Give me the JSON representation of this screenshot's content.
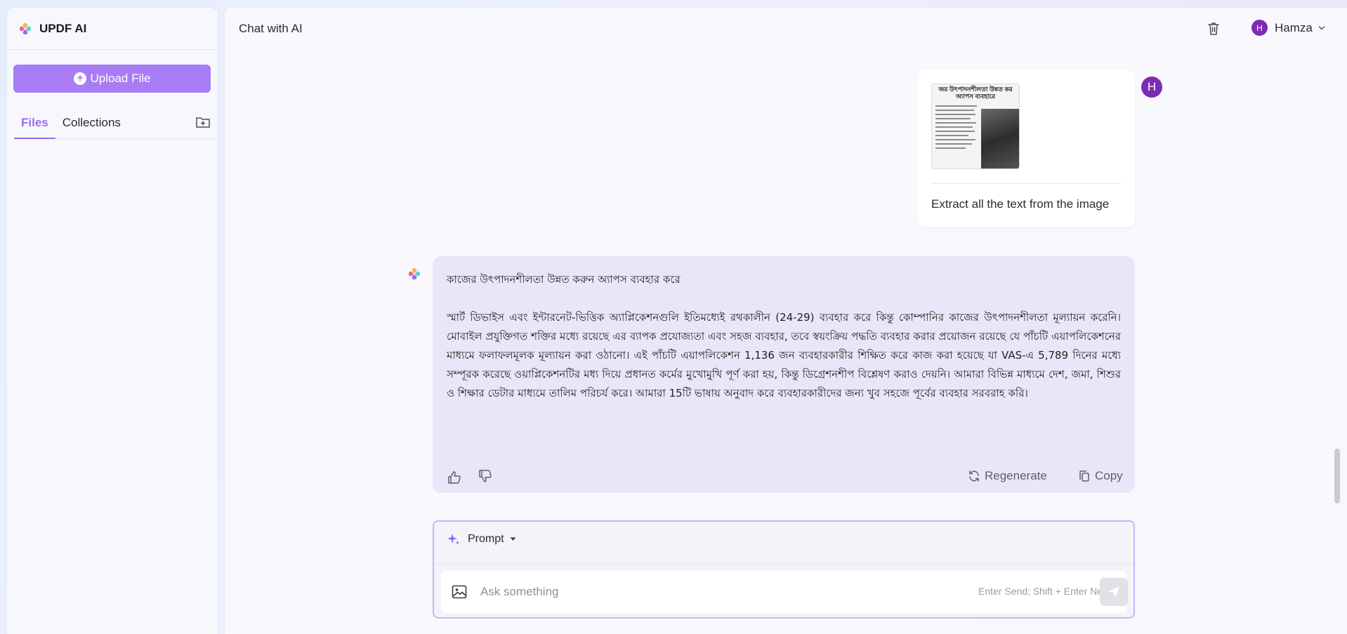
{
  "sidebar": {
    "brand": "UPDF AI",
    "upload_label": "Upload File",
    "tabs": [
      {
        "label": "Files"
      },
      {
        "label": "Collections"
      }
    ]
  },
  "header": {
    "title": "Chat with AI",
    "user_name": "Hamza",
    "user_initial": "H"
  },
  "user_message": {
    "thumb_title": "জর উৎপাদনশীলতা উন্নত কর অ্যাপস ব্যবহারে",
    "text": "Extract all the text from the image",
    "avatar_initial": "H"
  },
  "ai_message": {
    "title": "কাজের উৎপাদনশীলতা উন্নত করুন অ্যাপস ব্যবহার করে",
    "paragraph": "স্মার্ট ডিভাইস এবং ইন্টারনেট-ভিত্তিক অ্যাপ্লিকেশনগুলি ইতিমধ্যেই রথকালীন (24-29) ব্যবহার করে কিন্তু কোম্পানির কাজের উৎপাদনশীলতা মূল্যায়ন করেনি। মোবাইল প্রযুক্তিগত শক্তির মধ্যে রয়েছে এর ব্যাপক প্রযোজ্যতা এবং সহজ ব্যবহার, তবে স্বয়ংক্রিয় পদ্ধতি ব্যবহার করার প্রয়োজন রয়েছে যে পাঁচটি এয়াপলিকেশনের মাধ্যমে ফলাফলমূলক মূল্যায়ন করা ওঠানো। এই পাঁচটি এয়াপলিকেশন 1,136 জন ব্যবহারকারীর শিক্ষিত করে কাজ করা হয়েছে যা VAS-এ 5,789 দিনের মধ্যে সম্পূরক করেছে ওয়াপ্লিকেশনটির মধ্য দিয়ে প্রধানত কর্মের মুখোমুখি পূর্ণ করা হয়, কিন্তু ডিগ্রেশনশীপ বিশ্লেষণ করাও দেয়নি। আমারা বিভিন্ন মাধ্যমে দেশ, জমা, শিশুর ও শিক্ষার ডেটার মাধ্যমে তালিম পরিচর্য করে। আমারা 15টি ভাষায় অনুবাদ করে ব্যবহারকারীদের জন্য খুব সহজে পূর্বের ব্যবহার সরবরাহ করি।",
    "regenerate_label": "Regenerate",
    "copy_label": "Copy"
  },
  "composer": {
    "prompt_label": "Prompt",
    "placeholder": "Ask something",
    "hint": "Enter Send; Shift + Enter Newline"
  },
  "colors": {
    "accent": "#a77cf4",
    "avatar": "#7e2bb3",
    "ai_bubble": "#e8e7f7"
  }
}
